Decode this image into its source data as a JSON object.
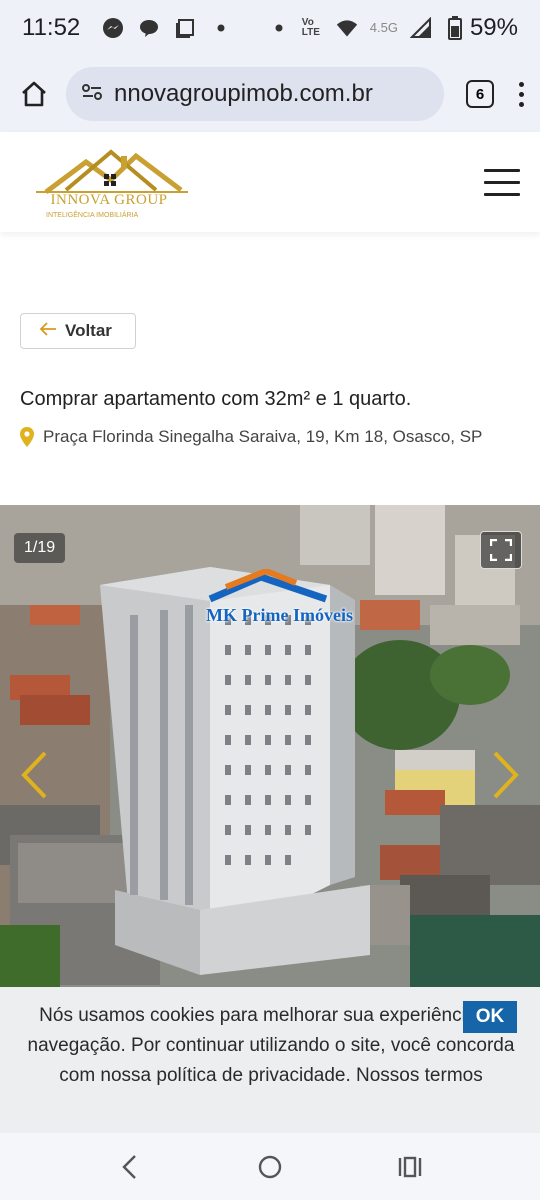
{
  "status_bar": {
    "time": "11:52",
    "battery": "59%",
    "network_small": "4.5G",
    "volte": "Vo LTE",
    "notification_icons": [
      "messenger-icon",
      "chat-icon",
      "copy-icon",
      "dot-icon"
    ]
  },
  "browser": {
    "url": "nnovagroupimob.com.br",
    "tab_count": "6"
  },
  "site": {
    "logo_title": "INNOVA GROUP",
    "logo_subtitle": "INTELIGÊNCIA IMOBILIÁRIA",
    "brand_color": "#c9a032"
  },
  "page": {
    "back_label": "Voltar",
    "title": "Comprar apartamento com 32m² e 1 quarto.",
    "address": "Praça Florinda Sinegalha Saraiva, 19, Km 18, Osasco, SP"
  },
  "gallery": {
    "counter": "1/19",
    "watermark": "MK Prime Imóveis",
    "arrow_color": "#e0b21d"
  },
  "cookie_banner": {
    "text": "Nós usamos cookies para melhorar sua experiência de navegação. Por continuar utilizando o site, você concorda com nossa política de privacidade. Nossos termos",
    "ok_label": "OK"
  },
  "system_nav": {
    "icons": [
      "back-icon",
      "home-icon",
      "recents-icon"
    ]
  }
}
